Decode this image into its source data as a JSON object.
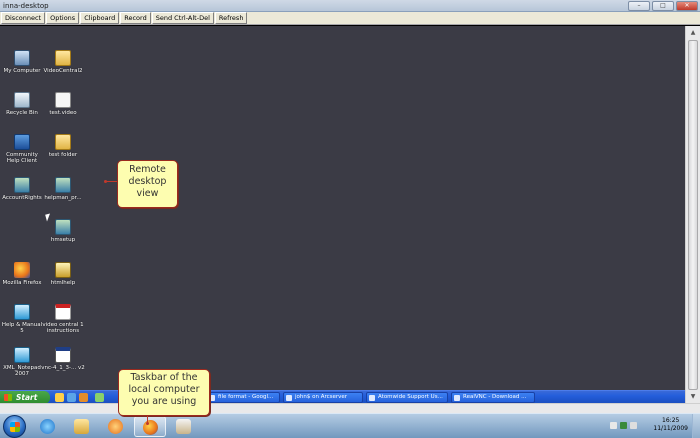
{
  "window": {
    "title": "inna-desktop",
    "controls": {
      "minimize": "–",
      "maximize": "□",
      "close": "✕"
    }
  },
  "toolbar": {
    "buttons": [
      "Disconnect",
      "Options",
      "Clipboard",
      "Record",
      "Send Ctrl-Alt-Del",
      "Refresh"
    ]
  },
  "desktop": {
    "icons": [
      {
        "label": "My Computer",
        "icon": "computer-icon"
      },
      {
        "label": "VideoCentral2",
        "icon": "folder-icon"
      },
      {
        "label": "Recycle Bin",
        "icon": "recycle-bin-icon"
      },
      {
        "label": "test.video",
        "icon": "video-file-icon"
      },
      {
        "label": "Community Help Client",
        "icon": "info-icon"
      },
      {
        "label": "test folder",
        "icon": "folder-icon"
      },
      {
        "label": "AccountRights",
        "icon": "setup-icon"
      },
      {
        "label": "helpman_pr...",
        "icon": "setup-icon"
      },
      {
        "label": "hmsetup",
        "icon": "setup-icon"
      },
      {
        "label": "Mozilla Firefox",
        "icon": "firefox-icon"
      },
      {
        "label": "htmlhelp",
        "icon": "html-help-icon"
      },
      {
        "label": "Help & Manual 5",
        "icon": "help-manual-icon"
      },
      {
        "label": "video central 1 instructions",
        "icon": "pdf-icon"
      },
      {
        "label": "XML_Notepad 2007",
        "icon": "xml-notepad-icon"
      },
      {
        "label": "vnc-4_1_3-... v2",
        "icon": "window-icon"
      }
    ]
  },
  "remote_taskbar": {
    "start_label": "Start",
    "tasks": [
      "file format - Googl...",
      "john$ on Arcserver",
      "Atomwide Support Us...",
      "RealVNC - Download ..."
    ]
  },
  "local_taskbar": {
    "pinned": [
      "internet-explorer-icon",
      "explorer-folder-icon",
      "media-player-icon",
      "firefox-icon",
      "app-icon"
    ],
    "clock": {
      "time": "16:25",
      "date": "11/11/2009"
    }
  },
  "callouts": {
    "remote": "Remote desktop view",
    "taskbar": "Taskbar of the local computer you are using"
  },
  "colors": {
    "remote_background": "#3b3b45",
    "callout_fill": "#fdfdb0",
    "callout_border": "#9b2a1e",
    "xp_taskbar": "#245edb",
    "start_button": "#2d8a2d"
  }
}
